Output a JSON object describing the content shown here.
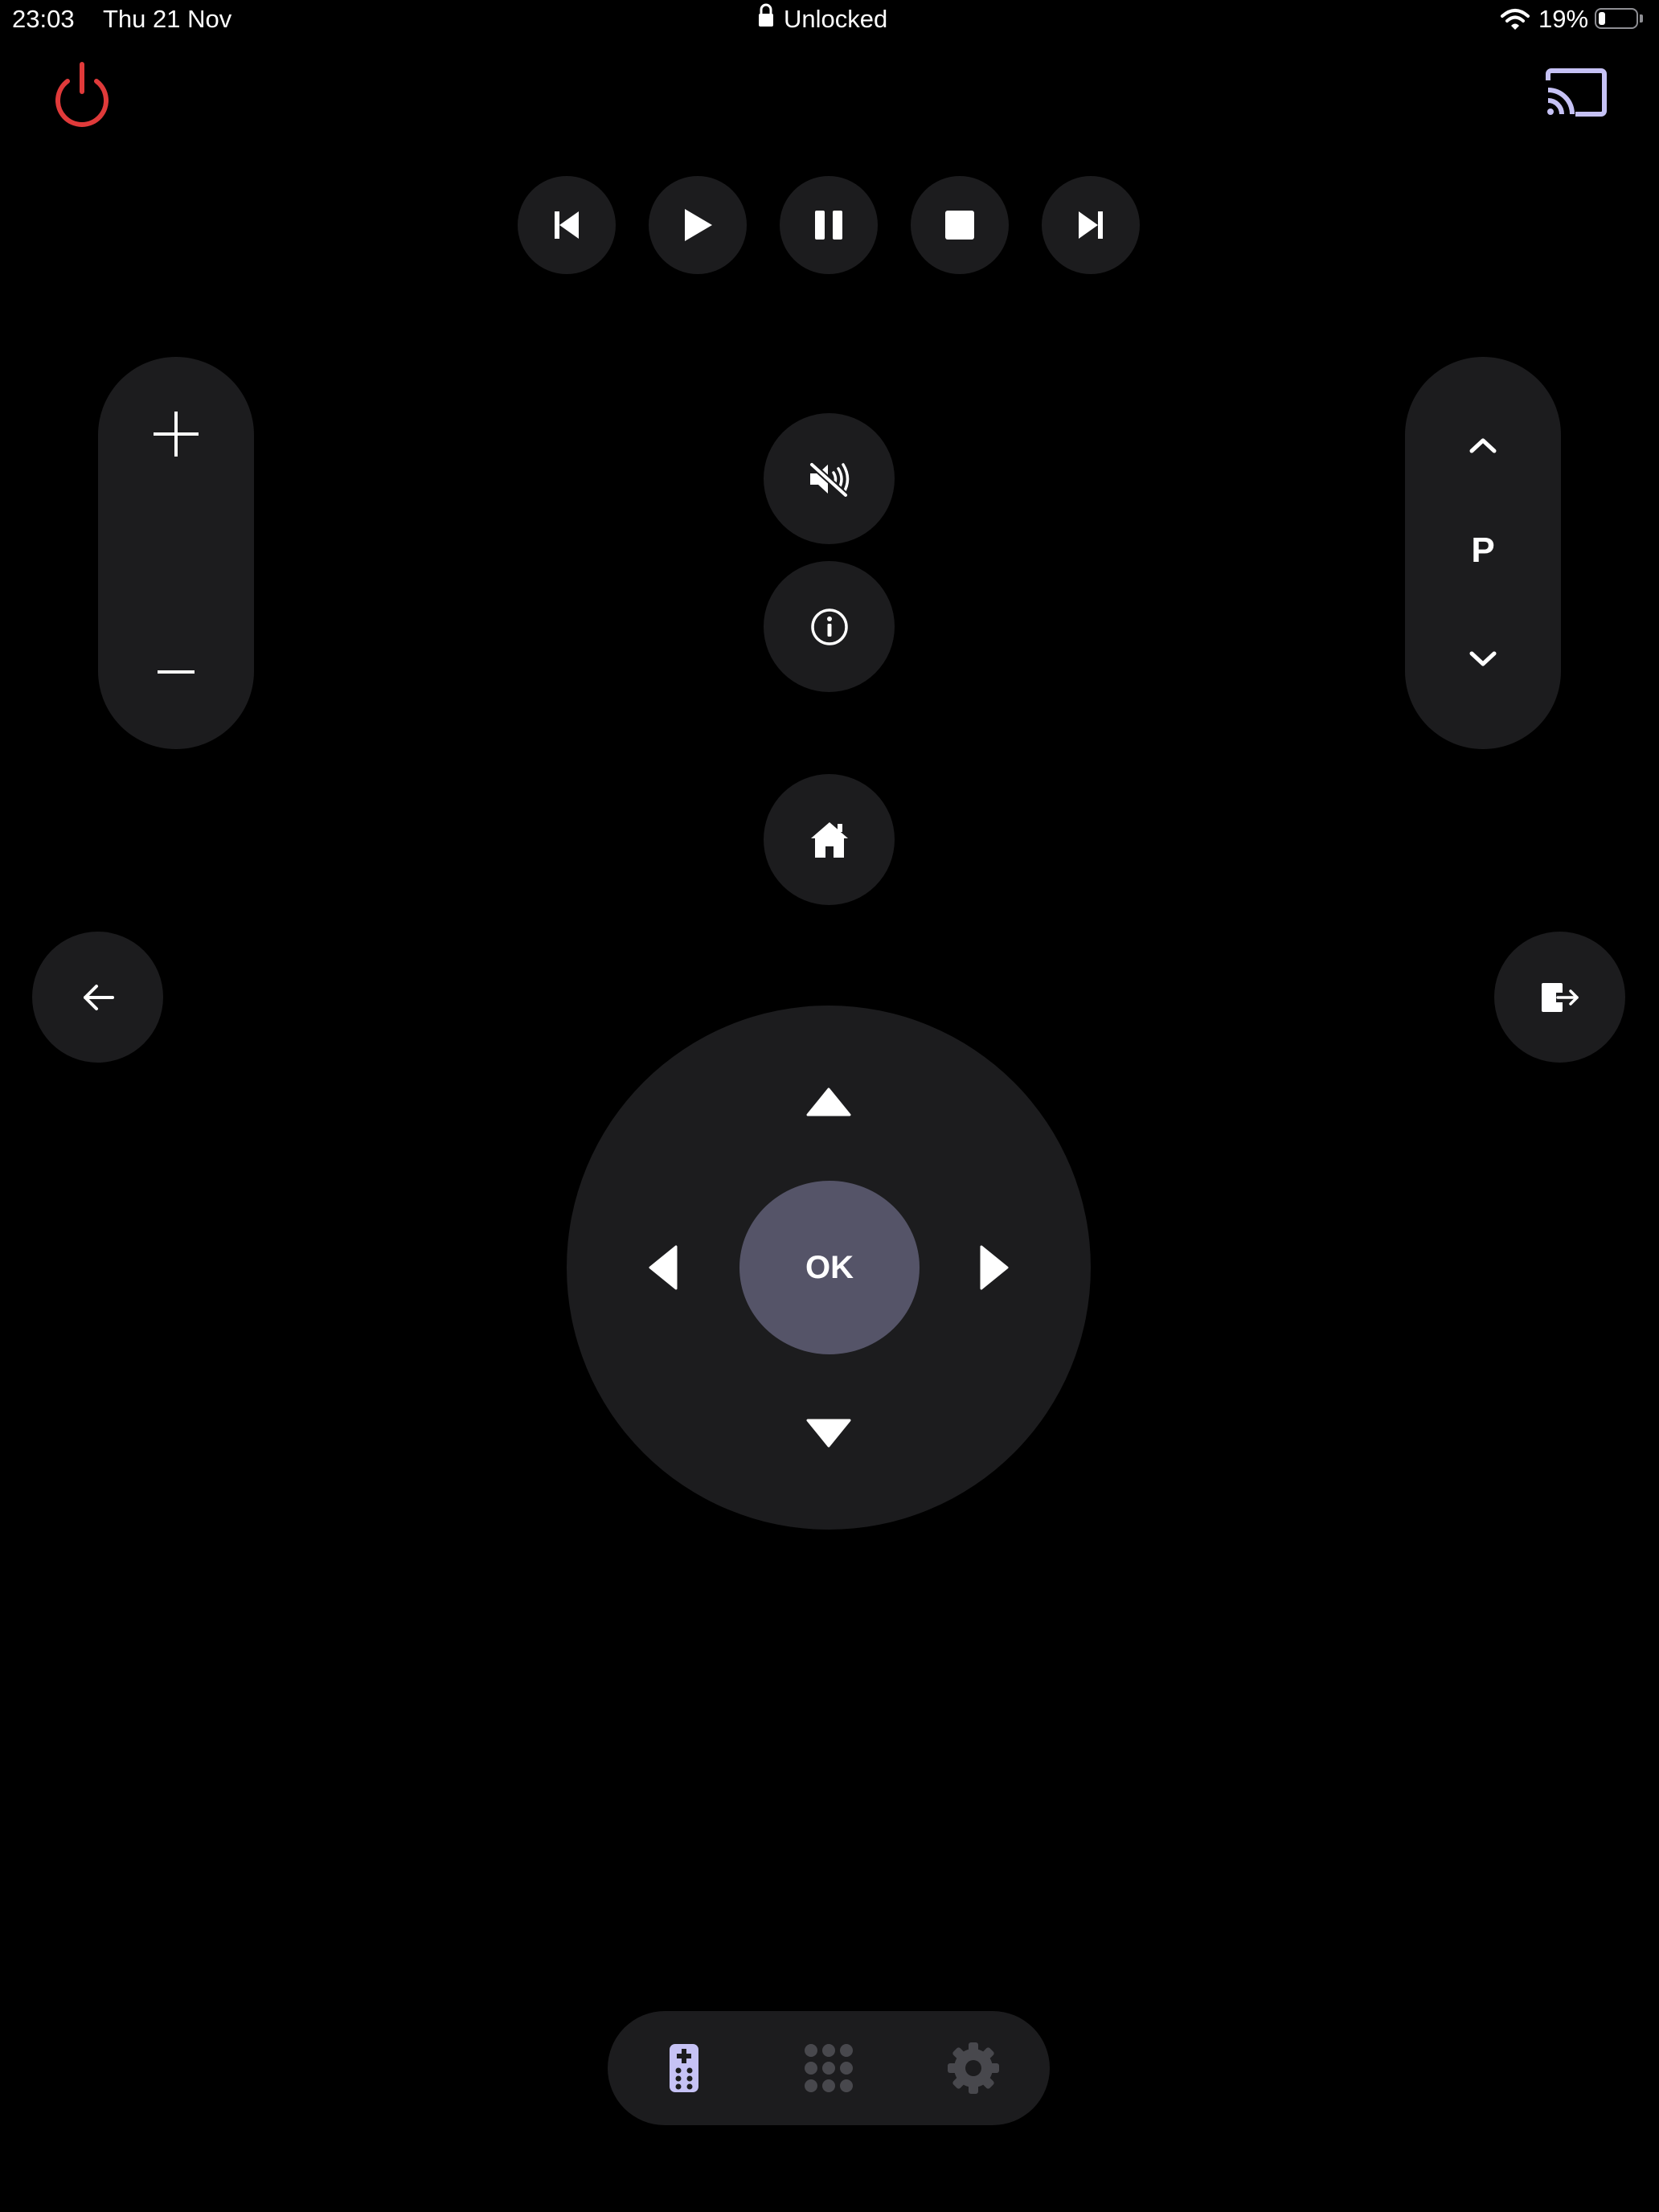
{
  "status_bar": {
    "time": "23:03",
    "date": "Thu 21 Nov",
    "lock_label": "Unlocked",
    "battery_percent": "19%",
    "battery_level": 0.19,
    "icons": [
      "lock-icon",
      "wifi-icon",
      "battery-icon"
    ]
  },
  "top_bar": {
    "power_icon": "power-icon",
    "cast_icon": "cast-icon"
  },
  "media_controls": [
    "skip-previous-icon",
    "play-icon",
    "pause-icon",
    "stop-icon",
    "skip-next-icon"
  ],
  "volume_rocker": {
    "up_icon": "plus-icon",
    "down_icon": "minus-icon"
  },
  "channel_rocker": {
    "label": "P",
    "up_icon": "chevron-up-icon",
    "down_icon": "chevron-down-icon"
  },
  "center_buttons": [
    "mute-icon",
    "info-icon",
    "home-icon"
  ],
  "nav_buttons": {
    "back_icon": "arrow-left-icon",
    "exit_icon": "exit-icon"
  },
  "dpad": {
    "ok_label": "OK",
    "directions": [
      "up",
      "left",
      "right",
      "down"
    ]
  },
  "bottom_nav": {
    "tabs": [
      {
        "name": "remote",
        "icon": "remote-icon",
        "active": true
      },
      {
        "name": "keypad",
        "icon": "keypad-icon",
        "active": false
      },
      {
        "name": "settings",
        "icon": "gear-icon",
        "active": false
      }
    ]
  },
  "colors": {
    "background": "#000000",
    "button": "#1c1c1e",
    "ok_button": "#555468",
    "power": "#e03a3a",
    "accent": "#c6c2f5",
    "inactive_tab": "#48484d"
  }
}
